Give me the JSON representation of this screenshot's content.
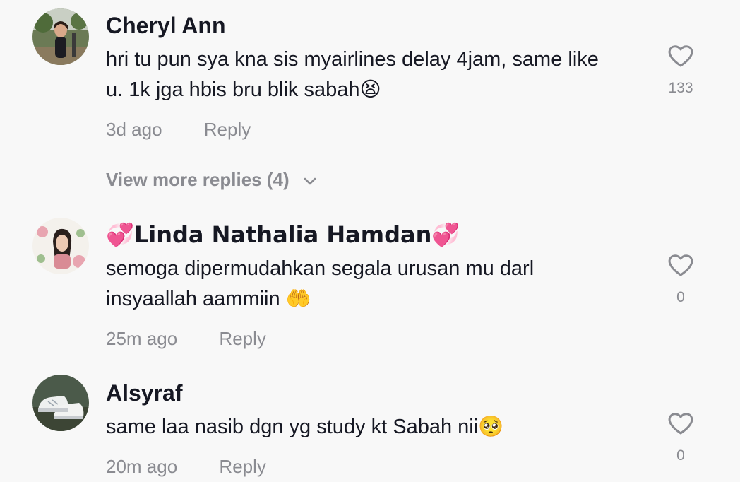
{
  "comments": [
    {
      "username": "Cheryl Ann",
      "text": "hri tu pun sya kna sis myairlines delay 4jam, same like\nu. 1k jga hbis bru blik sabah😫",
      "time": "3d ago",
      "reply_label": "Reply",
      "likes": "133",
      "view_more": "View more replies (4)"
    },
    {
      "username": "💞Linda Nathalia Hamdan💞",
      "text": "semoga dipermudahkan segala urusan mu darl\ninsyaallah aammiin 🤲",
      "time": "25m ago",
      "reply_label": "Reply",
      "likes": "0"
    },
    {
      "username": "Alsyraf",
      "text": "same laa nasib dgn yg study kt Sabah nii🥺",
      "time": "20m ago",
      "reply_label": "Reply",
      "likes": "0"
    }
  ],
  "icons": {
    "like": "heart-outline-icon",
    "expand": "chevron-down-icon"
  },
  "colors": {
    "background": "#f8f8f8",
    "username": "#161823",
    "secondary": "#8a8b91"
  }
}
